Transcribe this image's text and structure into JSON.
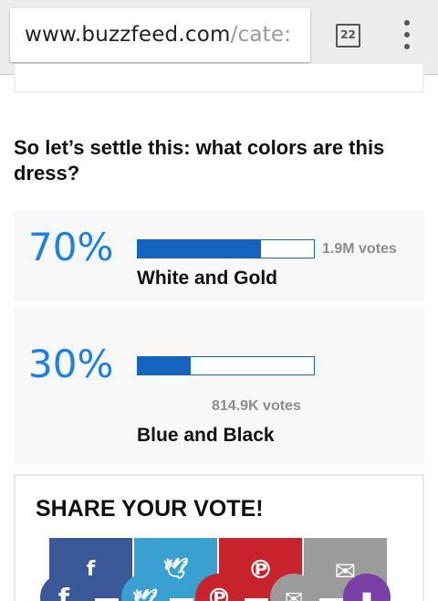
{
  "browser": {
    "url_domain": "www.buzzfeed.com",
    "url_path": "/cate:",
    "tab_count": "22"
  },
  "poll": {
    "question": "So let’s settle this: what colors are this dress?",
    "options": [
      {
        "percent_label": "70%",
        "percent": 70,
        "votes": "1.9M votes",
        "label": "White and Gold"
      },
      {
        "percent_label": "30%",
        "percent": 30,
        "votes": "814.9K votes",
        "label": "Blue and Black"
      }
    ]
  },
  "share": {
    "title": "SHARE YOUR VOTE!",
    "buttons": [
      {
        "name": "facebook",
        "icon": "facebook-icon",
        "glyph": "f",
        "color": "#3b5998",
        "circle_color": "#3b5998"
      },
      {
        "name": "twitter",
        "icon": "twitter-icon",
        "glyph": "🐦",
        "color": "#3aa0d2",
        "circle_color": "#3aa0d2"
      },
      {
        "name": "pinterest",
        "icon": "pinterest-icon",
        "glyph": "℗",
        "color": "#c8232c",
        "circle_color": "#c8232c"
      },
      {
        "name": "email",
        "icon": "email-icon",
        "glyph": "✉",
        "color": "#9b9b9b",
        "circle_color": "#9b9b9b"
      }
    ],
    "extra_button": {
      "icon": "bookmark-icon",
      "color": "#7b3fa8"
    }
  },
  "colors": {
    "accent": "#1c81e2",
    "bar": "#1565c0"
  }
}
